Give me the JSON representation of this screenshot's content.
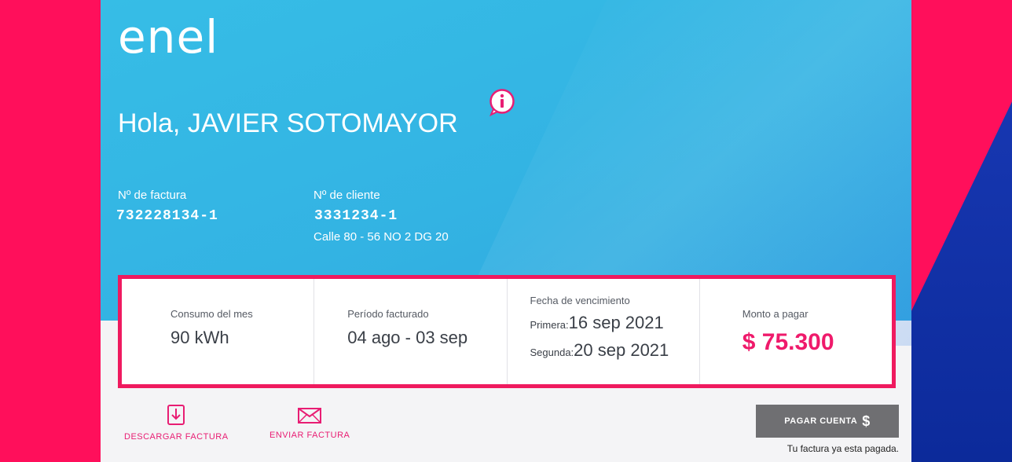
{
  "brand": {
    "logo_text": "enel"
  },
  "greeting": {
    "text": "Hola, JAVIER SOTOMAYOR"
  },
  "info_icon": {
    "glyph": "i",
    "color": "#e81d73"
  },
  "invoice": {
    "label": "Nº de factura",
    "value": "732228134-1"
  },
  "client": {
    "label": "Nº de cliente",
    "value": "3331234-1",
    "address": "Calle 80 - 56 NO 2 DG 20"
  },
  "summary": {
    "consumption": {
      "label": "Consumo del mes",
      "value": "90 kWh"
    },
    "period": {
      "label": "Período facturado",
      "value": "04 ago - 03 sep"
    },
    "due": {
      "label": "Fecha de vencimiento",
      "first_prefix": "Primera:",
      "first_date": "16 sep 2021",
      "second_prefix": "Segunda:",
      "second_date": "20 sep 2021"
    },
    "amount": {
      "label": "Monto a pagar",
      "value": "$ 75.300"
    }
  },
  "actions": {
    "download": {
      "label": "DESCARGAR FACTURA",
      "icon": "download-document-icon"
    },
    "send": {
      "label": "ENVIAR FACTURA",
      "icon": "envelope-icon"
    }
  },
  "pay": {
    "label": "PAGAR CUENTA",
    "symbol": "$",
    "note": "Tu factura ya esta pagada."
  },
  "colors": {
    "accent": "#e81d73",
    "hero_blue": "#36bde6",
    "frame_pink": "#ff0f5b",
    "button_gray": "#6f6f72"
  }
}
